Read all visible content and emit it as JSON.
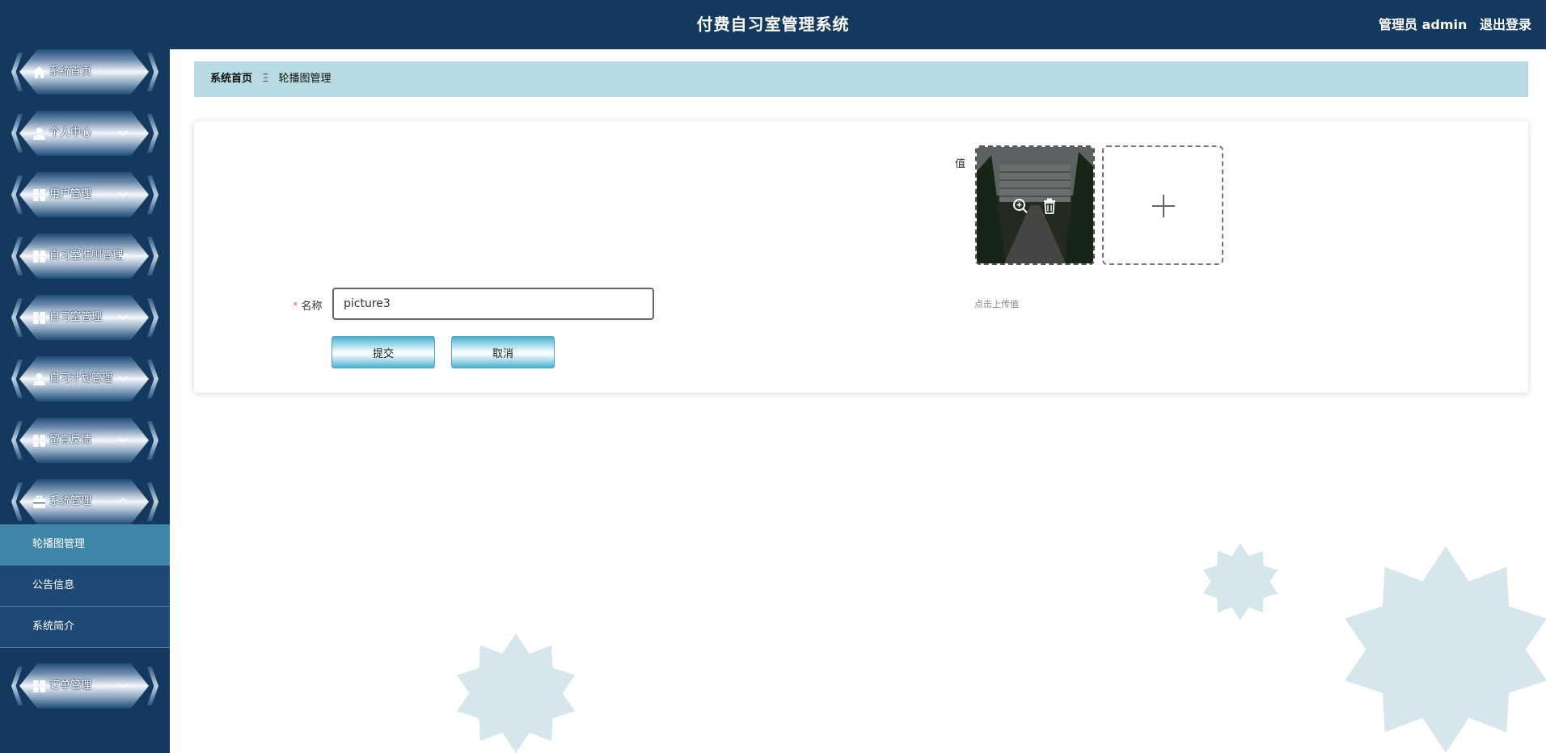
{
  "header": {
    "title": "付费自习室管理系统",
    "user": "管理员 admin",
    "logout": "退出登录"
  },
  "sidebar": {
    "items": [
      {
        "label": "系统首页",
        "icon": "home-icon",
        "has_chevron": false
      },
      {
        "label": "个人中心",
        "icon": "user-icon",
        "has_chevron": true
      },
      {
        "label": "用户管理",
        "icon": "grid-icon",
        "has_chevron": true
      },
      {
        "label": "自习室准则管理",
        "icon": "grid-icon",
        "has_chevron": true
      },
      {
        "label": "自习室管理",
        "icon": "grid-icon",
        "has_chevron": true
      },
      {
        "label": "自习计划管理",
        "icon": "user-icon",
        "has_chevron": true
      },
      {
        "label": "留言反馈",
        "icon": "grid-icon",
        "has_chevron": true
      },
      {
        "label": "系统管理",
        "icon": "briefcase-icon",
        "has_chevron": true,
        "expanded": true
      },
      {
        "label": "订单管理",
        "icon": "grid-icon",
        "has_chevron": true
      }
    ],
    "submenu": [
      {
        "label": "轮播图管理",
        "active": true
      },
      {
        "label": "公告信息",
        "active": false
      },
      {
        "label": "系统简介",
        "active": false
      }
    ]
  },
  "breadcrumb": {
    "home": "系统首页",
    "separator": "Ξ",
    "current": "轮播图管理"
  },
  "form": {
    "name_label": "名称",
    "required_mark": "*",
    "name_value": "picture3",
    "value_label": "值",
    "upload_tip": "点击上传值",
    "submit_label": "提交",
    "cancel_label": "取消"
  },
  "colors": {
    "header_bg": "#133a5e",
    "breadcrumb_bg": "#b7dbe3",
    "submenu_active": "#3f86a8",
    "required": "#f56c6c"
  }
}
